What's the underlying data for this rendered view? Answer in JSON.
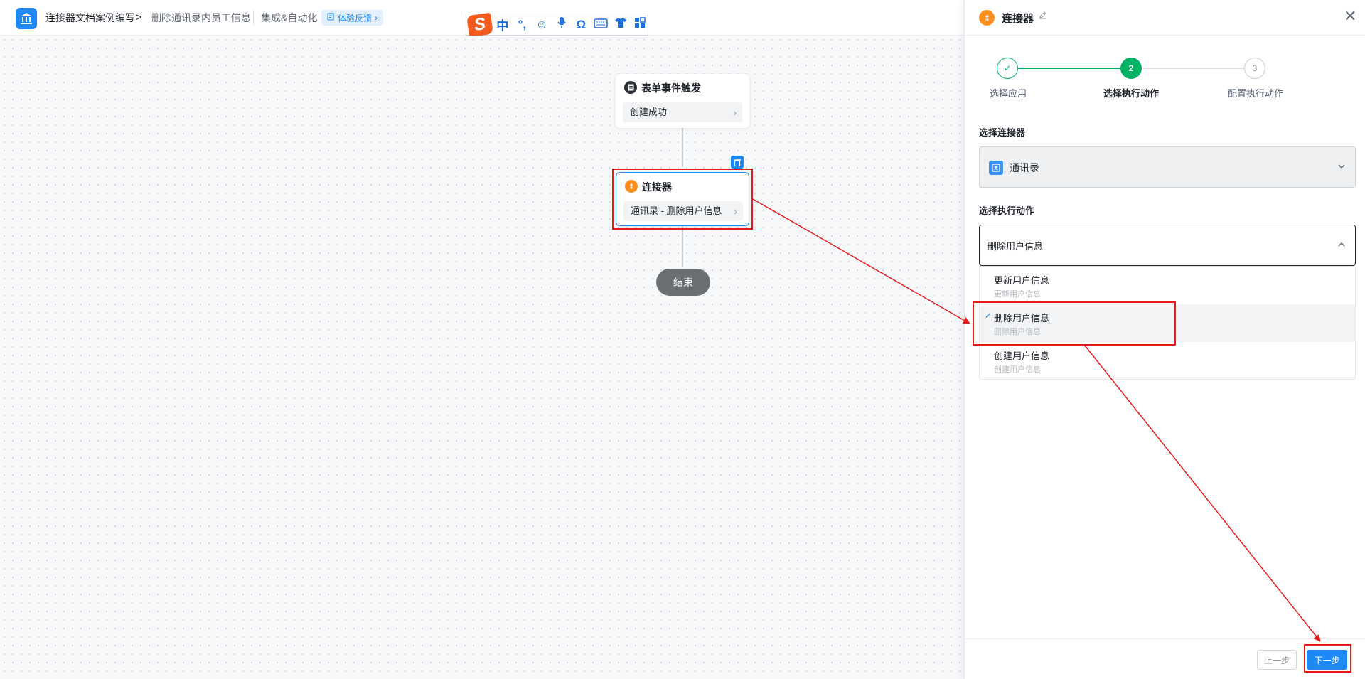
{
  "header": {
    "app_name": "连接器文档案例编写",
    "separator": ">",
    "page_name": "删除通讯录内员工信息",
    "integration_label": "集成&自动化",
    "feedback_label": "体验反馈",
    "feedback_chevron": "›",
    "app_icon": "bank-icon"
  },
  "ime_toolbar": {
    "logo": "S",
    "items": [
      "中",
      "°,",
      "☺",
      "🎤",
      "Ω",
      "⌨",
      "👕",
      "▦"
    ]
  },
  "canvas": {
    "trigger_node": {
      "title": "表单事件触发",
      "subtitle": "创建成功",
      "icon": "form-icon"
    },
    "connector_node": {
      "title": "连接器",
      "subtitle": "通讯录 - 删除用户信息",
      "icon": "connector-icon"
    },
    "end_node": {
      "label": "结束"
    },
    "chevron": "›"
  },
  "panel": {
    "title": "连接器",
    "close": "✕",
    "steps": [
      {
        "label": "选择应用",
        "status": "done",
        "marker": "✓"
      },
      {
        "label": "选择执行动作",
        "status": "active",
        "marker": "2"
      },
      {
        "label": "配置执行动作",
        "status": "pending",
        "marker": "3"
      }
    ],
    "connector_field": {
      "label": "选择连接器",
      "value": "通讯录",
      "arrow": "⌄"
    },
    "action_field": {
      "label": "选择执行动作",
      "value": "删除用户信息",
      "arrow": "⌃"
    },
    "options": [
      {
        "title": "更新用户信息",
        "desc": "更新用户信息",
        "selected": false
      },
      {
        "title": "删除用户信息",
        "desc": "删除用户信息",
        "selected": true,
        "check": "✓"
      },
      {
        "title": "创建用户信息",
        "desc": "创建用户信息",
        "selected": false
      }
    ],
    "footer": {
      "prev_label": "上一步",
      "next_label": "下一步"
    }
  },
  "colors": {
    "primary": "#1e88f5",
    "success": "#00b365",
    "connector_orange": "#ff8f1f",
    "annotation_red": "#e61b1b"
  }
}
